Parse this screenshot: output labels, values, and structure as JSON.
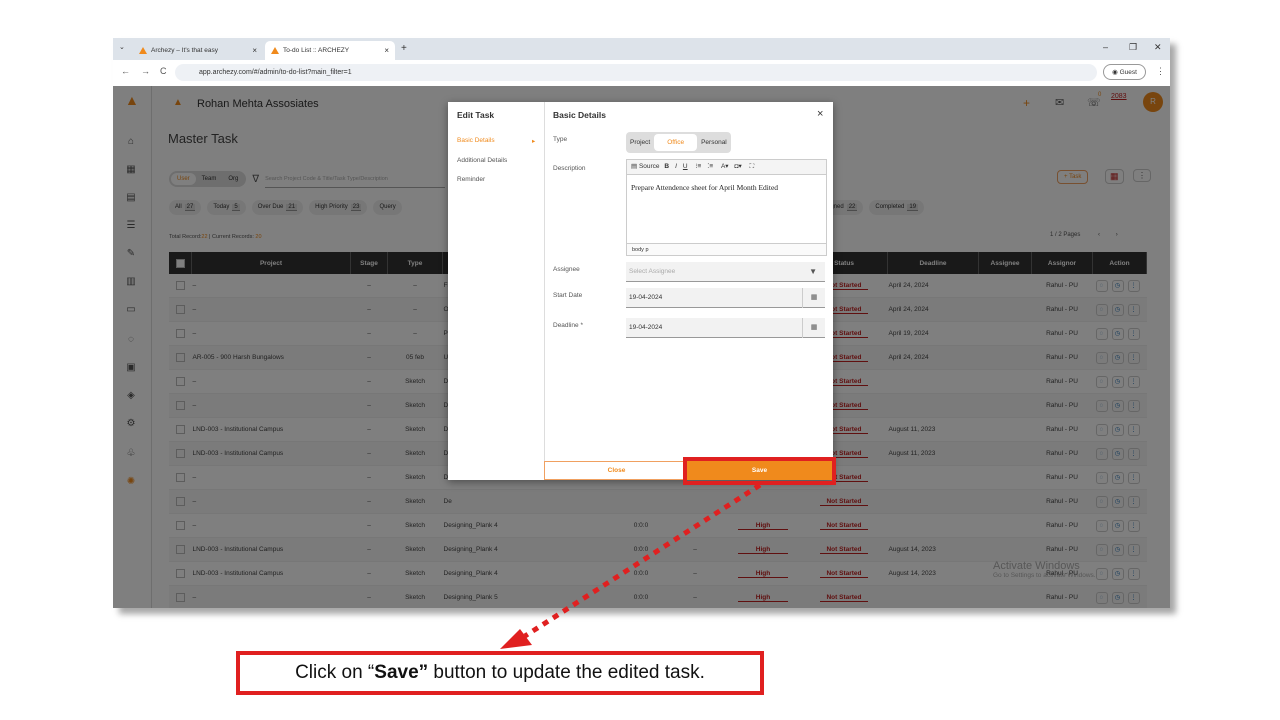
{
  "browser": {
    "tabs": [
      {
        "title": "Archezy – It's that easy"
      },
      {
        "title": "To-do List :: ARCHEZY"
      }
    ],
    "url": "app.archezy.com/#/admin/to-do-list?main_filter=1",
    "guest_label": "Guest"
  },
  "app": {
    "company": "Rohan Mehta Assosiates",
    "page_title": "Master Task",
    "notif_count": "0",
    "year": "2083",
    "avatar_letter": "R",
    "seg": {
      "user": "User",
      "team": "Team",
      "org": "Org"
    },
    "search_placeholder": "Search Project Code & Title/Task Type/Description",
    "add_task_label": "+ Task",
    "filters": [
      {
        "label": "All",
        "count": "27"
      },
      {
        "label": "Today",
        "count": "5"
      },
      {
        "label": "Over Due",
        "count": "21"
      },
      {
        "label": "High Priority",
        "count": "23"
      },
      {
        "label": "Query",
        "count": ""
      }
    ],
    "right_filters": [
      {
        "label": "Assigned",
        "count": "22"
      },
      {
        "label": "Completed",
        "count": "19"
      }
    ],
    "records_prefix": "Total Record:",
    "records_total": "22",
    "records_mid": " | Current Records: ",
    "records_current": "20",
    "pages": "1 / 2 Pages",
    "columns": [
      "Project",
      "Stage",
      "Type",
      "Status",
      "Deadline",
      "Assignee",
      "Assignor",
      "Action"
    ],
    "rows": [
      {
        "project": "–",
        "stage": "–",
        "type": "–",
        "task": "Fix",
        "time": "",
        "dash": "",
        "prio": "",
        "status": "Not Started",
        "deadline": "April 24, 2024",
        "assignor": "Rahul - PU"
      },
      {
        "project": "–",
        "stage": "–",
        "type": "–",
        "task": "Of",
        "time": "",
        "dash": "",
        "prio": "",
        "status": "Not Started",
        "deadline": "April 24, 2024",
        "assignor": "Rahul - PU"
      },
      {
        "project": "–",
        "stage": "–",
        "type": "–",
        "task": "Pr",
        "time": "",
        "dash": "",
        "prio": "",
        "status": "Not Started",
        "deadline": "April 19, 2024",
        "assignor": "Rahul - PU"
      },
      {
        "project": "AR-005 - 900 Harsh Bungalows",
        "stage": "–",
        "type": "05 feb",
        "task": "Un",
        "time": "",
        "dash": "",
        "prio": "",
        "status": "Not Started",
        "deadline": "April 24, 2024",
        "assignor": "Rahul - PU"
      },
      {
        "project": "–",
        "stage": "–",
        "type": "Sketch",
        "task": "De",
        "time": "",
        "dash": "",
        "prio": "",
        "status": "Not Started",
        "deadline": "",
        "assignor": "Rahul - PU"
      },
      {
        "project": "–",
        "stage": "–",
        "type": "Sketch",
        "task": "De",
        "time": "",
        "dash": "",
        "prio": "",
        "status": "Not Started",
        "deadline": "",
        "assignor": "Rahul - PU"
      },
      {
        "project": "LND-003 - Institutional Campus",
        "stage": "–",
        "type": "Sketch",
        "task": "De",
        "time": "",
        "dash": "",
        "prio": "",
        "status": "Not Started",
        "deadline": "August 11, 2023",
        "assignor": "Rahul - PU"
      },
      {
        "project": "LND-003 - Institutional Campus",
        "stage": "–",
        "type": "Sketch",
        "task": "De",
        "time": "",
        "dash": "",
        "prio": "",
        "status": "Not Started",
        "deadline": "August 11, 2023",
        "assignor": "Rahul - PU"
      },
      {
        "project": "–",
        "stage": "–",
        "type": "Sketch",
        "task": "De",
        "time": "",
        "dash": "",
        "prio": "",
        "status": "Not Started",
        "deadline": "",
        "assignor": "Rahul - PU"
      },
      {
        "project": "–",
        "stage": "–",
        "type": "Sketch",
        "task": "De",
        "time": "",
        "dash": "",
        "prio": "",
        "status": "Not Started",
        "deadline": "",
        "assignor": "Rahul - PU"
      },
      {
        "project": "–",
        "stage": "–",
        "type": "Sketch",
        "task": "Designing_Plank 4",
        "time": "0:0:0",
        "dash": "–",
        "prio": "High",
        "status": "Not Started",
        "deadline": "",
        "assignor": "Rahul - PU"
      },
      {
        "project": "LND-003 - Institutional Campus",
        "stage": "–",
        "type": "Sketch",
        "task": "Designing_Plank 4",
        "time": "0:0:0",
        "dash": "–",
        "prio": "High",
        "status": "Not Started",
        "deadline": "August 14, 2023",
        "assignor": "Rahul - PU"
      },
      {
        "project": "LND-003 - Institutional Campus",
        "stage": "–",
        "type": "Sketch",
        "task": "Designing_Plank 4",
        "time": "0:0:0",
        "dash": "–",
        "prio": "High",
        "status": "Not Started",
        "deadline": "August 14, 2023",
        "assignor": "Rahul - PU"
      },
      {
        "project": "–",
        "stage": "–",
        "type": "Sketch",
        "task": "Designing_Plank 5",
        "time": "0:0:0",
        "dash": "–",
        "prio": "High",
        "status": "Not Started",
        "deadline": "",
        "assignor": "Rahul - PU"
      },
      {
        "project": "–",
        "stage": "–",
        "type": "Sketch",
        "task": "Designing_Plank 5",
        "time": "0:0:0",
        "dash": "–",
        "prio": "High",
        "status": "Not Started",
        "deadline": "",
        "assignor": "Rahul - PU"
      }
    ],
    "watermark_title": "Activate Windows",
    "watermark_sub": "Go to Settings to activate Windows."
  },
  "modal": {
    "left_title": "Edit Task",
    "nav": [
      "Basic Details",
      "Additional Details",
      "Reminder"
    ],
    "title": "Basic Details",
    "close_icon": "×",
    "type_label": "Type",
    "type_options": [
      "Project",
      "Office",
      "Personal"
    ],
    "description_label": "Description",
    "editor_source": "Source",
    "description_text": "Prepare Attendence sheet for April Month Edited",
    "editor_path": "body  p",
    "assignee_label": "Assignee",
    "assignee_placeholder": "Select Assignee",
    "start_label": "Start Date",
    "start_value": "19-04-2024",
    "deadline_label": "Deadline *",
    "deadline_value": "19-04-2024",
    "close_btn": "Close",
    "save_btn": "Save"
  },
  "callout": {
    "pre": "Click on “",
    "bold": "Save”",
    "post": " button to update the edited task."
  },
  "colors": {
    "accent": "#f08a1c",
    "highlight": "#e02020"
  }
}
